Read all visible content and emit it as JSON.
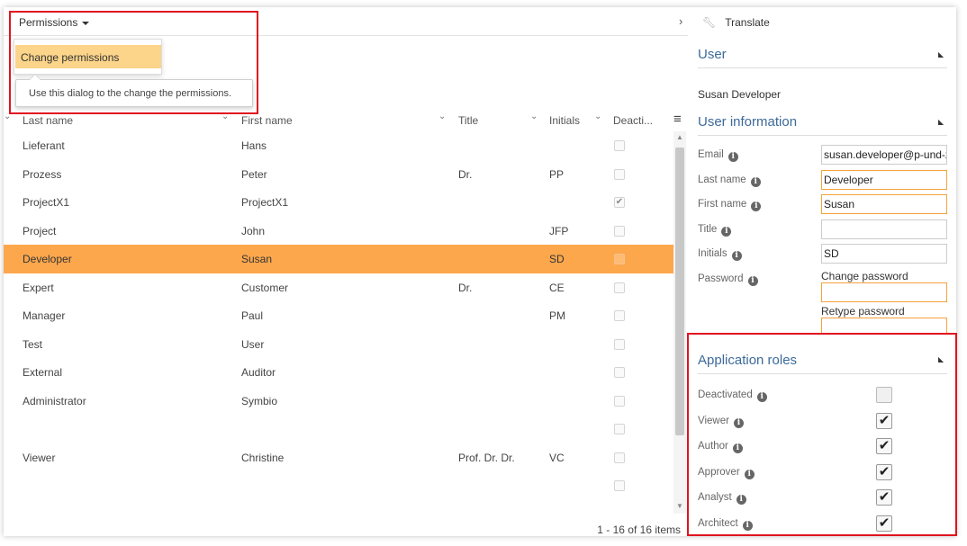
{
  "toolbar": {
    "permissions_label": "Permissions"
  },
  "dropdown": {
    "item": "Change permissions"
  },
  "tooltip": {
    "text": "Use this dialog to the change the permissions."
  },
  "grid": {
    "columns": [
      "Last name",
      "First name",
      "Title",
      "Initials",
      "Deacti..."
    ],
    "rows": [
      {
        "last": "Lieferant",
        "first": "Hans",
        "title": "",
        "initials": "",
        "deactivated": false
      },
      {
        "last": "Prozess",
        "first": "Peter",
        "title": "Dr.",
        "initials": "PP",
        "deactivated": false
      },
      {
        "last": "ProjectX1",
        "first": "ProjectX1",
        "title": "",
        "initials": "",
        "deactivated": true
      },
      {
        "last": "Project",
        "first": "John",
        "title": "",
        "initials": "JFP",
        "deactivated": false
      },
      {
        "last": "Developer",
        "first": "Susan",
        "title": "",
        "initials": "SD",
        "deactivated": false,
        "selected": true
      },
      {
        "last": "Expert",
        "first": "Customer",
        "title": "Dr.",
        "initials": "CE",
        "deactivated": false
      },
      {
        "last": "Manager",
        "first": "Paul",
        "title": "",
        "initials": "PM",
        "deactivated": false
      },
      {
        "last": "Test",
        "first": "User",
        "title": "",
        "initials": "",
        "deactivated": false
      },
      {
        "last": "External",
        "first": "Auditor",
        "title": "",
        "initials": "",
        "deactivated": false
      },
      {
        "last": "Administrator",
        "first": "Symbio",
        "title": "",
        "initials": "",
        "deactivated": false
      },
      {
        "last": "",
        "first": "",
        "title": "",
        "initials": "",
        "deactivated": false
      },
      {
        "last": "Viewer",
        "first": "Christine",
        "title": "Prof. Dr. Dr.",
        "initials": "VC",
        "deactivated": false
      },
      {
        "last": "",
        "first": "",
        "title": "",
        "initials": "",
        "deactivated": false
      }
    ],
    "pager": "1 - 16 of 16 items"
  },
  "right": {
    "translate": "Translate",
    "user_title": "User",
    "user_name": "Susan Developer",
    "info_title": "User information",
    "fields": {
      "email_label": "Email",
      "email_value": "susan.developer@p-und-z",
      "last_label": "Last name",
      "last_value": "Developer",
      "first_label": "First name",
      "first_value": "Susan",
      "title_label": "Title",
      "title_value": "",
      "initials_label": "Initials",
      "initials_value": "SD",
      "password_label": "Password",
      "change_pw": "Change password",
      "retype_pw": "Retype password"
    },
    "roles_title": "Application roles",
    "roles": [
      {
        "label": "Deactivated",
        "checked": false
      },
      {
        "label": "Viewer",
        "checked": true
      },
      {
        "label": "Author",
        "checked": true
      },
      {
        "label": "Approver",
        "checked": true
      },
      {
        "label": "Analyst",
        "checked": true
      },
      {
        "label": "Architect",
        "checked": true
      }
    ]
  },
  "colors": {
    "accent": "#fda74d",
    "dropdown_highlight": "#fcd48a",
    "heading": "#3d6a9a",
    "highlight_box": "#e0141e"
  }
}
